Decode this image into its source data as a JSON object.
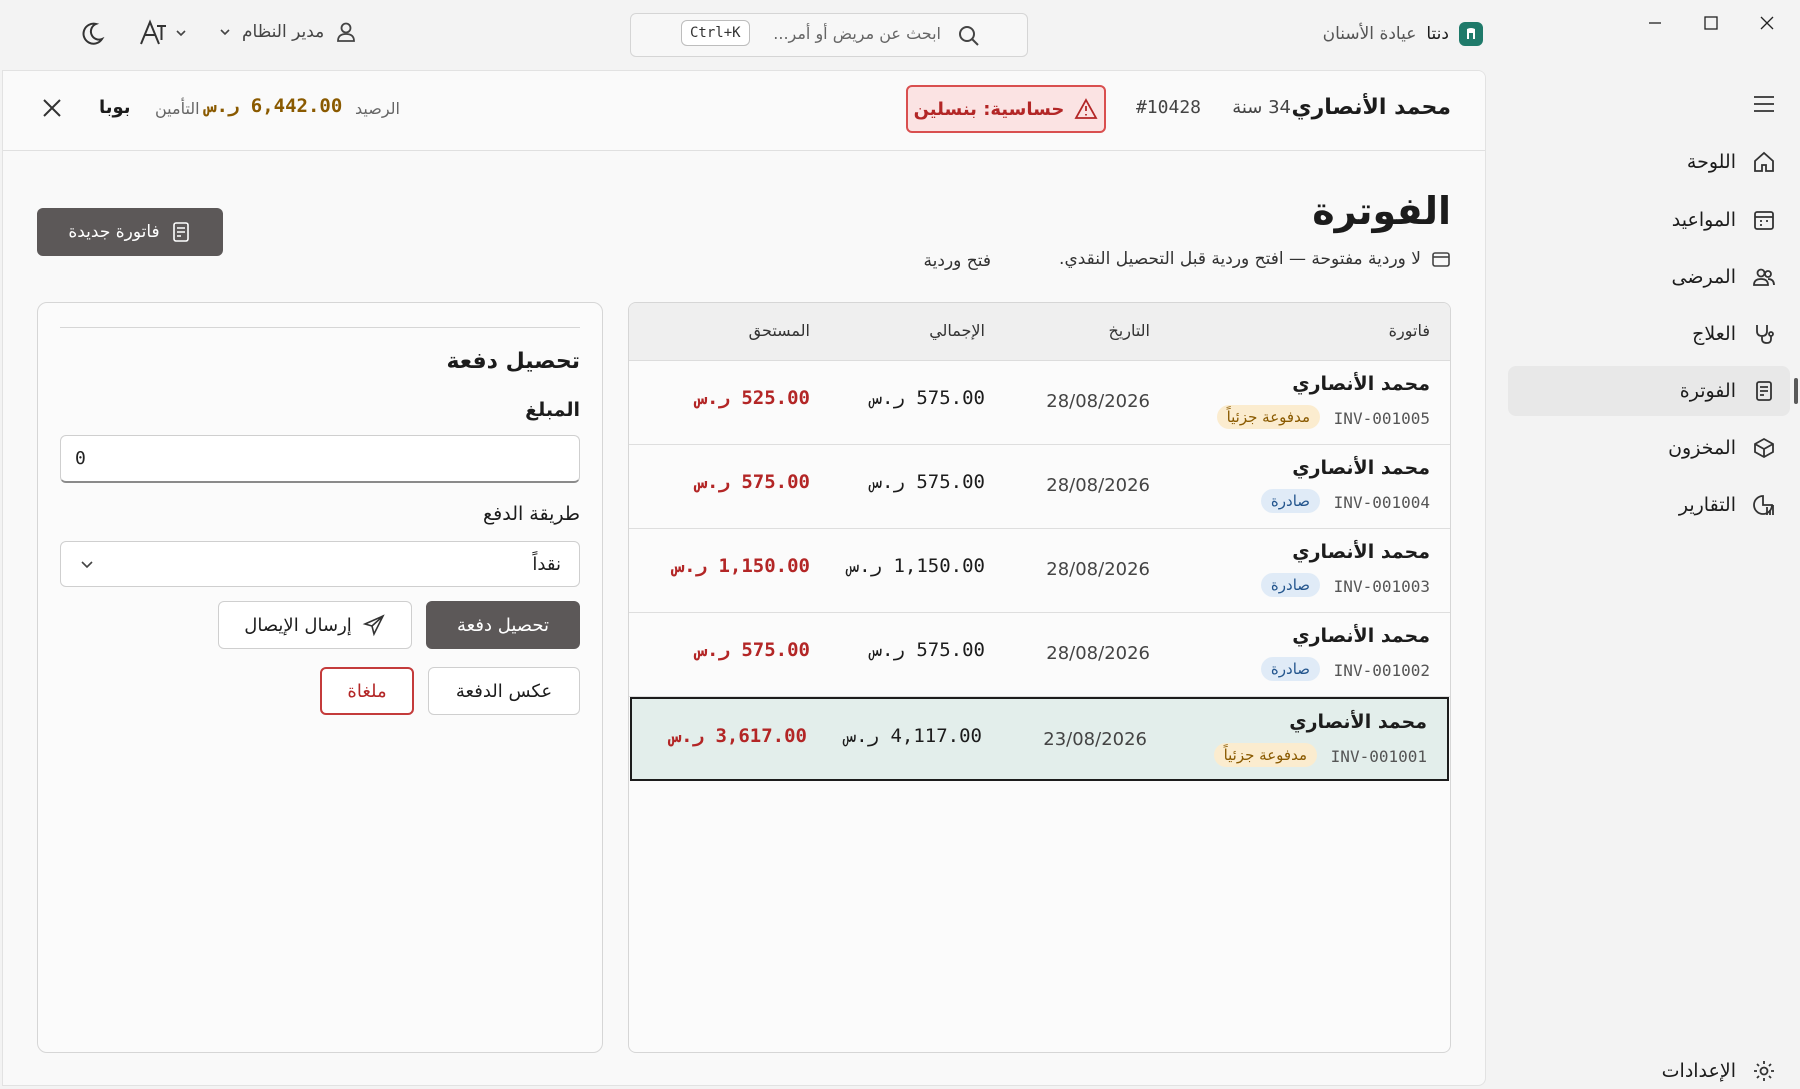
{
  "titlebar": {
    "brand_name": "دنتا",
    "brand_sub": "عيادة الأسنان",
    "search_placeholder": "ابحث عن مريض أو أمر...",
    "search_shortcut": "Ctrl+K",
    "user_label": "مدير النظام"
  },
  "sidebar": {
    "items": [
      {
        "label": "اللوحة",
        "icon": "home-icon"
      },
      {
        "label": "المواعيد",
        "icon": "calendar-icon"
      },
      {
        "label": "المرضى",
        "icon": "users-icon"
      },
      {
        "label": "العلاج",
        "icon": "stethoscope-icon"
      },
      {
        "label": "الفوترة",
        "icon": "invoice-icon"
      },
      {
        "label": "المخزون",
        "icon": "box-icon"
      },
      {
        "label": "التقارير",
        "icon": "chart-icon"
      }
    ],
    "settings_label": "الإعدادات"
  },
  "patient": {
    "name": "محمد الأنصاري",
    "age": "34 سنة",
    "id": "#10428",
    "allergy": "حساسية: بنسلين",
    "balance_label": "الرصيد",
    "balance_value": "6,442.00 ر.س",
    "insurance_label": "التأمين",
    "insurance_value": "بوبا"
  },
  "billing": {
    "title": "الفوترة",
    "shift_note": "لا وردية مفتوحة — افتح وردية قبل التحصيل النقدي.",
    "open_shift": "فتح وردية",
    "new_invoice": "فاتورة جديدة"
  },
  "table": {
    "headers": {
      "invoice": "فاتورة",
      "date": "التاريخ",
      "total": "الإجمالي",
      "due": "المستحق"
    },
    "rows": [
      {
        "name": "محمد الأنصاري",
        "inv": "INV-001005",
        "status": "مدفوعة جزئياً",
        "date": "28/08/2026",
        "total": "575.00 ر.س",
        "due": "525.00 ر.س"
      },
      {
        "name": "محمد الأنصاري",
        "inv": "INV-001004",
        "status": "صادرة",
        "date": "28/08/2026",
        "total": "575.00 ر.س",
        "due": "575.00 ر.س"
      },
      {
        "name": "محمد الأنصاري",
        "inv": "INV-001003",
        "status": "صادرة",
        "date": "28/08/2026",
        "total": "1,150.00 ر.س",
        "due": "1,150.00 ر.س"
      },
      {
        "name": "محمد الأنصاري",
        "inv": "INV-001002",
        "status": "صادرة",
        "date": "28/08/2026",
        "total": "575.00 ر.س",
        "due": "575.00 ر.س"
      },
      {
        "name": "محمد الأنصاري",
        "inv": "INV-001001",
        "status": "مدفوعة جزئياً",
        "date": "23/08/2026",
        "total": "4,117.00 ر.س",
        "due": "3,617.00 ر.س"
      }
    ]
  },
  "payment": {
    "title": "تحصيل دفعة",
    "amount_label": "المبلغ",
    "amount_value": "0",
    "method_label": "طريقة الدفع",
    "method_value": "نقداً",
    "collect_label": "تحصيل دفعة",
    "receipt_label": "إرسال الإيصال",
    "reverse_label": "عكس الدفعة",
    "void_label": "ملغاة"
  },
  "colors": {
    "accent": "#5c5858",
    "danger": "#b32626",
    "warning_text": "#8a5a00",
    "selected_row": "#e3eeeb"
  }
}
